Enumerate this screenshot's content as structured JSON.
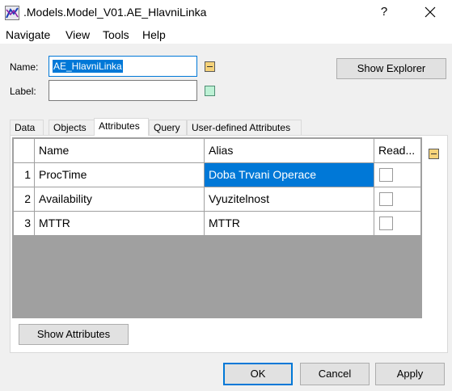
{
  "window": {
    "title": ".Models.Model_V01.AE_HlavniLinka",
    "help_glyph": "?",
    "close_glyph": "✕"
  },
  "menu": [
    "Navigate",
    "View",
    "Tools",
    "Help"
  ],
  "form": {
    "name_label": "Name:",
    "name_value": "AE_HlavniLinka",
    "label_label": "Label:",
    "label_value": "",
    "show_explorer_label": "Show Explorer"
  },
  "tabs": [
    "Data",
    "Objects",
    "Attributes",
    "Query",
    "User-defined Attributes"
  ],
  "active_tab": "Attributes",
  "table": {
    "columns": [
      "Name",
      "Alias",
      "Read..."
    ],
    "rows": [
      {
        "num": "1",
        "name": "ProcTime",
        "alias": "Doba Trvani Operace",
        "read_only": false,
        "selected": true
      },
      {
        "num": "2",
        "name": "Availability",
        "alias": "Vyuzitelnost",
        "read_only": false,
        "selected": false
      },
      {
        "num": "3",
        "name": "MTTR",
        "alias": "MTTR",
        "read_only": false,
        "selected": false
      }
    ]
  },
  "buttons": {
    "show_attributes": "Show Attributes",
    "ok": "OK",
    "cancel": "Cancel",
    "apply": "Apply"
  },
  "colors": {
    "accent": "#0078d7",
    "object_icon": "#f6d37a",
    "label_icon": "#bdf1d5",
    "grid_empty": "#a0a0a0"
  },
  "icons": {
    "app": "plant-simulation-icon",
    "name_side": "object-minus-icon",
    "label_side": "label-color-icon",
    "table_side": "object-minus-icon"
  }
}
